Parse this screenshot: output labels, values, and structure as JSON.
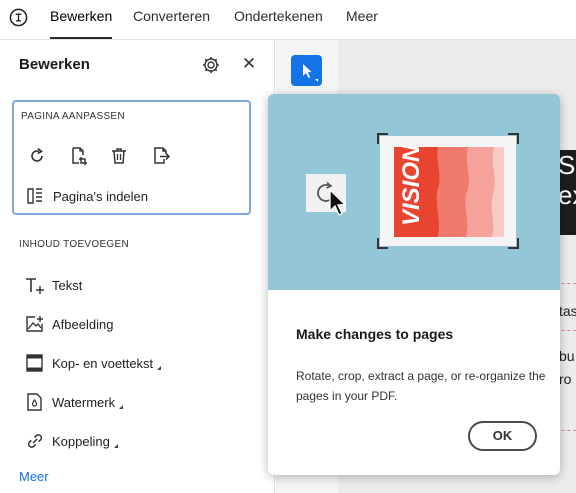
{
  "topbar": {
    "tabs": [
      {
        "label": "Bewerken",
        "active": true
      },
      {
        "label": "Converteren",
        "active": false
      },
      {
        "label": "Ondertekenen",
        "active": false
      },
      {
        "label": "Meer",
        "active": false
      }
    ]
  },
  "panel": {
    "title": "Bewerken",
    "page_section": {
      "heading": "PAGINA AANPASSEN",
      "tools": [
        "rotate-icon",
        "crop-page-icon",
        "delete-icon",
        "extract-page-icon"
      ],
      "organize_label": "Pagina's indelen"
    },
    "content_section": {
      "heading": "INHOUD TOEVOEGEN",
      "items": [
        {
          "label": "Tekst",
          "icon": "text-add-icon",
          "has_submenu": false
        },
        {
          "label": "Afbeelding",
          "icon": "image-add-icon",
          "has_submenu": false
        },
        {
          "label": "Kop- en voettekst",
          "icon": "header-footer-icon",
          "has_submenu": true
        },
        {
          "label": "Watermerk",
          "icon": "watermark-icon",
          "has_submenu": true
        },
        {
          "label": "Koppeling",
          "icon": "link-icon",
          "has_submenu": true
        }
      ]
    },
    "more_label": "Meer"
  },
  "popover": {
    "illustration_text": "VISION",
    "title": "Make changes to pages",
    "body": "Rotate, crop, extract a page, or re-organize the pages in your PDF.",
    "ok_label": "OK"
  },
  "document": {
    "peek_texts": [
      "S",
      "ex",
      "tas",
      "bu",
      "ro"
    ]
  },
  "colors": {
    "accent": "#1473e6",
    "card_border": "#7fa9de",
    "hero_bg": "#93c6d7",
    "vision_red": "#e8442f"
  }
}
